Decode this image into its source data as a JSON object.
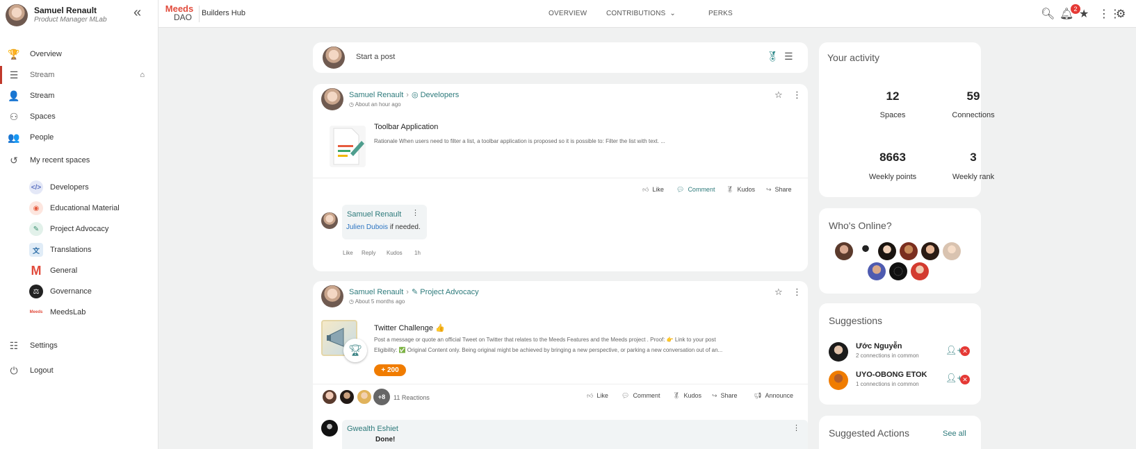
{
  "profile": {
    "name": "Samuel Renault",
    "role": "Product Manager MLab"
  },
  "sidebar": {
    "collapse_icon": "«",
    "items": [
      {
        "label": "Overview",
        "icon": "trophy-icon"
      },
      {
        "label": "Stream",
        "icon": "stream-icon"
      },
      {
        "label": "Stream",
        "icon": "user-lock-icon"
      },
      {
        "label": "Spaces",
        "icon": "spaces-icon"
      },
      {
        "label": "People",
        "icon": "people-icon"
      },
      {
        "label": "My recent spaces",
        "icon": "history-icon"
      }
    ],
    "spaces": [
      {
        "label": "Developers",
        "color": "#5a6fbf",
        "glyph": "</>"
      },
      {
        "label": "Educational Material",
        "color": "#e65b3e",
        "glyph": "◉"
      },
      {
        "label": "Project Advocacy",
        "color": "#3a8f6f",
        "glyph": "✎"
      },
      {
        "label": "Translations",
        "color": "#2f6fa8",
        "glyph": "文A"
      },
      {
        "label": "General",
        "color": "#e14b3c",
        "glyph": "M"
      },
      {
        "label": "Governance",
        "color": "#222222",
        "glyph": "⚖"
      },
      {
        "label": "MeedsLab",
        "color": "#e14b3c",
        "glyph": "Meeds"
      }
    ],
    "bottom": [
      {
        "label": "Settings",
        "icon": "sliders-icon"
      },
      {
        "label": "Logout",
        "icon": "power-icon"
      }
    ]
  },
  "topbar": {
    "logo_top": "Meeds",
    "logo_bottom": "DAO",
    "brand": "Builders Hub",
    "nav": [
      "OVERVIEW",
      "CONTRIBUTIONS",
      "PERKS"
    ],
    "notification_count": "2"
  },
  "composer": {
    "placeholder": "Start a post"
  },
  "posts": [
    {
      "author": "Samuel Renault",
      "space": "Developers",
      "time": "About an hour ago",
      "title": "Toolbar Application",
      "description": "Rationale  When users need to filter a list, a toolbar application is proposed so it is possible to:   Filter the list with text.  ...",
      "actions": [
        "Like",
        "Comment",
        "Kudos",
        "Share"
      ],
      "comment": {
        "author": "Samuel Renault",
        "mention": "Julien Dubois",
        "text": " if needed.",
        "actions": [
          "Like",
          "Reply",
          "Kudos",
          "1h"
        ]
      }
    },
    {
      "author": "Samuel Renault",
      "space": "Project Advocacy",
      "time": "About 5 months ago",
      "title": "Twitter Challenge 👍",
      "line1": "Post a message or quote an official Tweet on Twitter that relates to the Meeds Features and the Meeds project . Proof: 👉 Link to your post",
      "line2": "Eligibility: ✅ Original Content only. Being original might be achieved by bringing a new perspective, or parking a new conversation out of an...",
      "points": "+ 200",
      "reactions_more": "+8",
      "reactions_count": "11 Reactions",
      "actions": [
        "Like",
        "Comment",
        "Kudos",
        "Share",
        "Announce"
      ],
      "comment": {
        "author": "Gwealth Eshiet",
        "text": "Done!"
      }
    }
  ],
  "activity": {
    "title": "Your activity",
    "stats": [
      {
        "value": "12",
        "label": "Spaces"
      },
      {
        "value": "59",
        "label": "Connections"
      },
      {
        "value": "8663",
        "label": "Weekly points"
      },
      {
        "value": "3",
        "label": "Weekly rank"
      }
    ]
  },
  "online": {
    "title": "Who's Online?"
  },
  "suggestions": {
    "title": "Suggestions",
    "people": [
      {
        "name": "Ước Nguyễn",
        "sub": "2 connections in common"
      },
      {
        "name": "UYO-OBONG ETOK",
        "sub": "1 connections in common"
      }
    ]
  },
  "suggested_actions": {
    "title": "Suggested Actions",
    "see_all": "See all"
  },
  "colors": {
    "accent": "#2d7a7b",
    "brand": "#e14b3c",
    "badge": "#e53935",
    "points": "#f07c00"
  }
}
